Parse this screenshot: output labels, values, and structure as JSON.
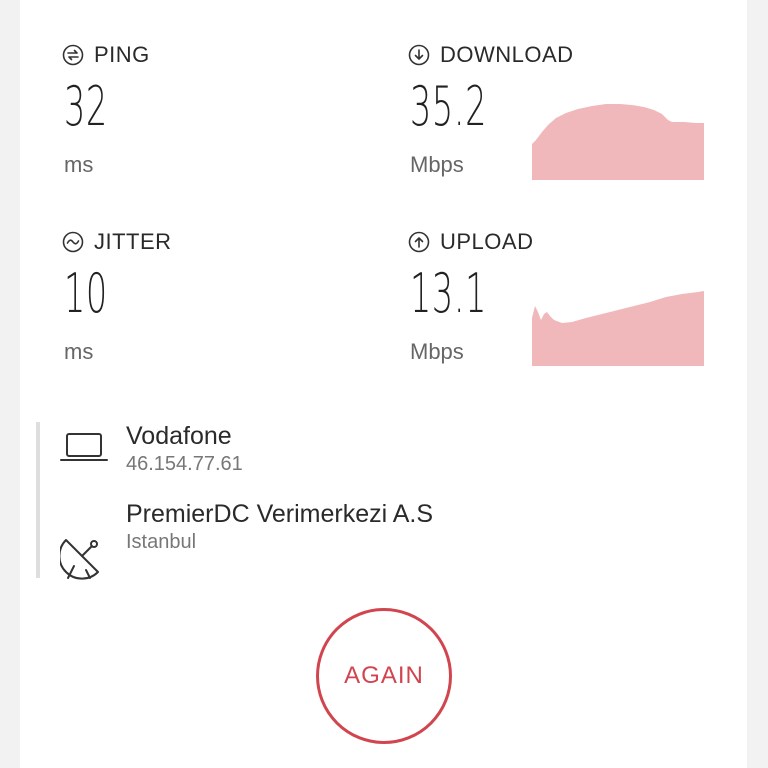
{
  "metrics": {
    "ping": {
      "label": "PING",
      "value": "32",
      "unit": "ms",
      "icon": "swap-arrows-icon"
    },
    "download": {
      "label": "DOWNLOAD",
      "value": "35.2",
      "unit": "Mbps",
      "icon": "arrow-down-circle-icon"
    },
    "jitter": {
      "label": "JITTER",
      "value": "10",
      "unit": "ms",
      "icon": "wave-circle-icon"
    },
    "upload": {
      "label": "UPLOAD",
      "value": "13.1",
      "unit": "Mbps",
      "icon": "arrow-up-circle-icon"
    }
  },
  "provider": {
    "name": "Vodafone",
    "ip": "46.154.77.61",
    "icon": "laptop-icon"
  },
  "server": {
    "name": "PremierDC Verimerkezi A.S",
    "location": "Istanbul",
    "icon": "satellite-dish-icon"
  },
  "again_button": {
    "label": "AGAIN"
  },
  "colors": {
    "accent": "#d1454f",
    "graph_fill": "#f0b8bb",
    "text": "#2a2a2a",
    "muted": "#777777"
  }
}
